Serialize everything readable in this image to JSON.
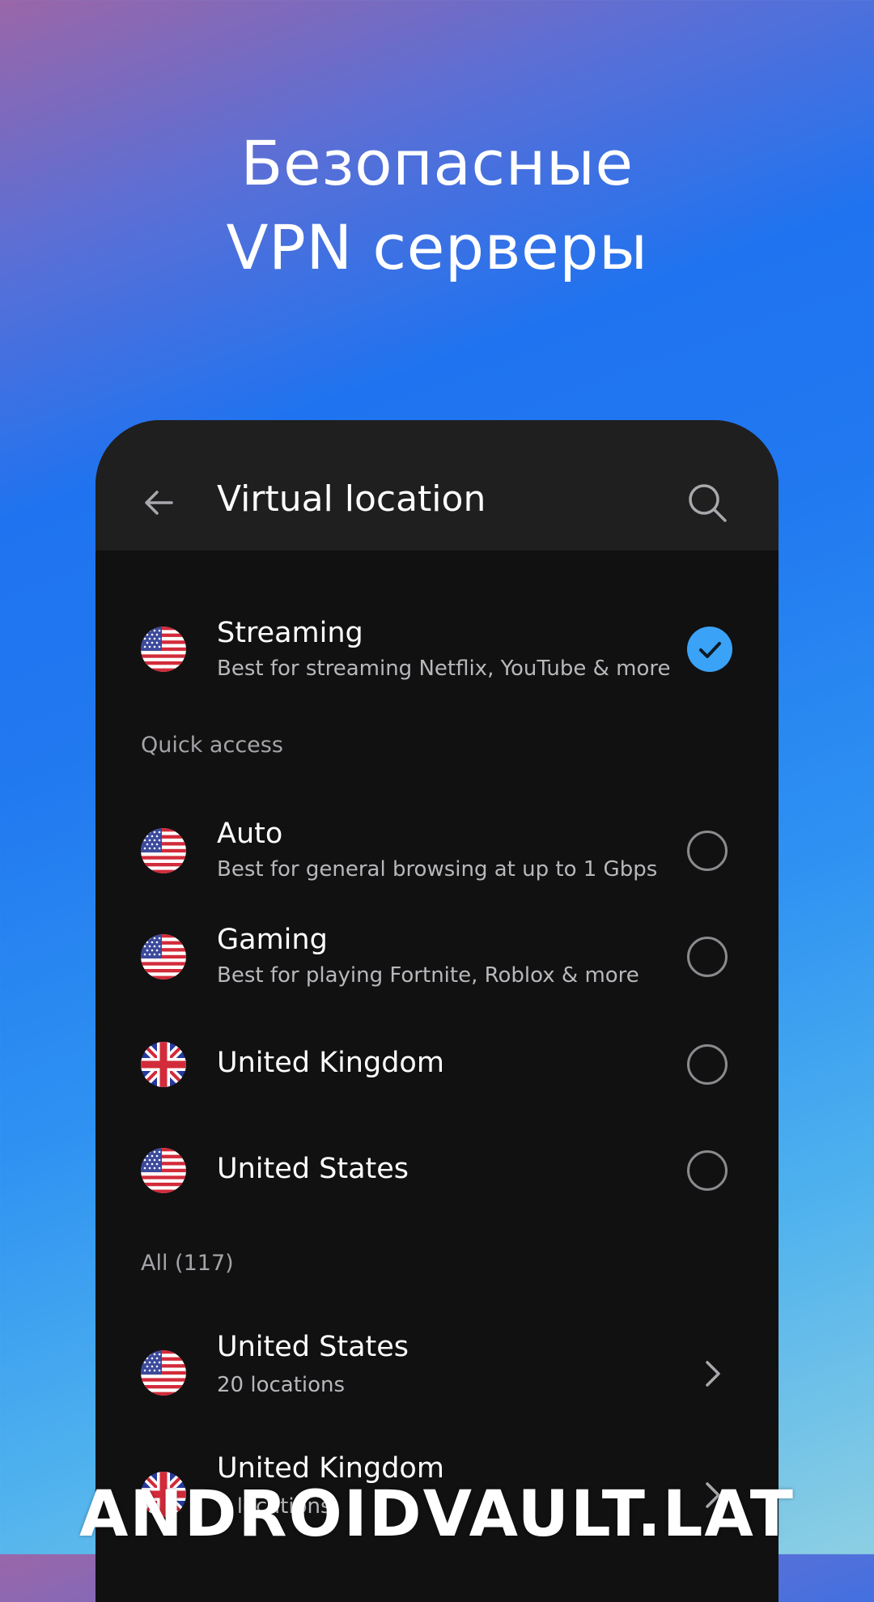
{
  "promo": {
    "line1": "Безопасные",
    "line2": "VPN серверы"
  },
  "appbar": {
    "title": "Virtual location",
    "back_icon": "arrow-left-icon",
    "search_icon": "search-icon"
  },
  "selected": {
    "title": "Streaming",
    "subtitle": "Best for streaming Netflix, YouTube & more",
    "flag": "us",
    "selected": true
  },
  "quick_access": {
    "label": "Quick access",
    "items": [
      {
        "title": "Auto",
        "subtitle": "Best for general browsing at up to 1 Gbps",
        "flag": "us"
      },
      {
        "title": "Gaming",
        "subtitle": "Best for playing Fortnite, Roblox & more",
        "flag": "us"
      },
      {
        "title": "United Kingdom",
        "subtitle": "",
        "flag": "uk"
      },
      {
        "title": "United States",
        "subtitle": "",
        "flag": "us"
      }
    ]
  },
  "all": {
    "label": "All (117)",
    "items": [
      {
        "title": "United States",
        "subtitle": "20 locations",
        "flag": "us"
      },
      {
        "title": "United Kingdom",
        "subtitle": "7 locations",
        "flag": "uk"
      }
    ]
  },
  "colors": {
    "accent": "#3aa3f7",
    "panel": "#111112",
    "appbar": "#1f1f20"
  },
  "watermark": "ANDROIDVAULT.LAT"
}
